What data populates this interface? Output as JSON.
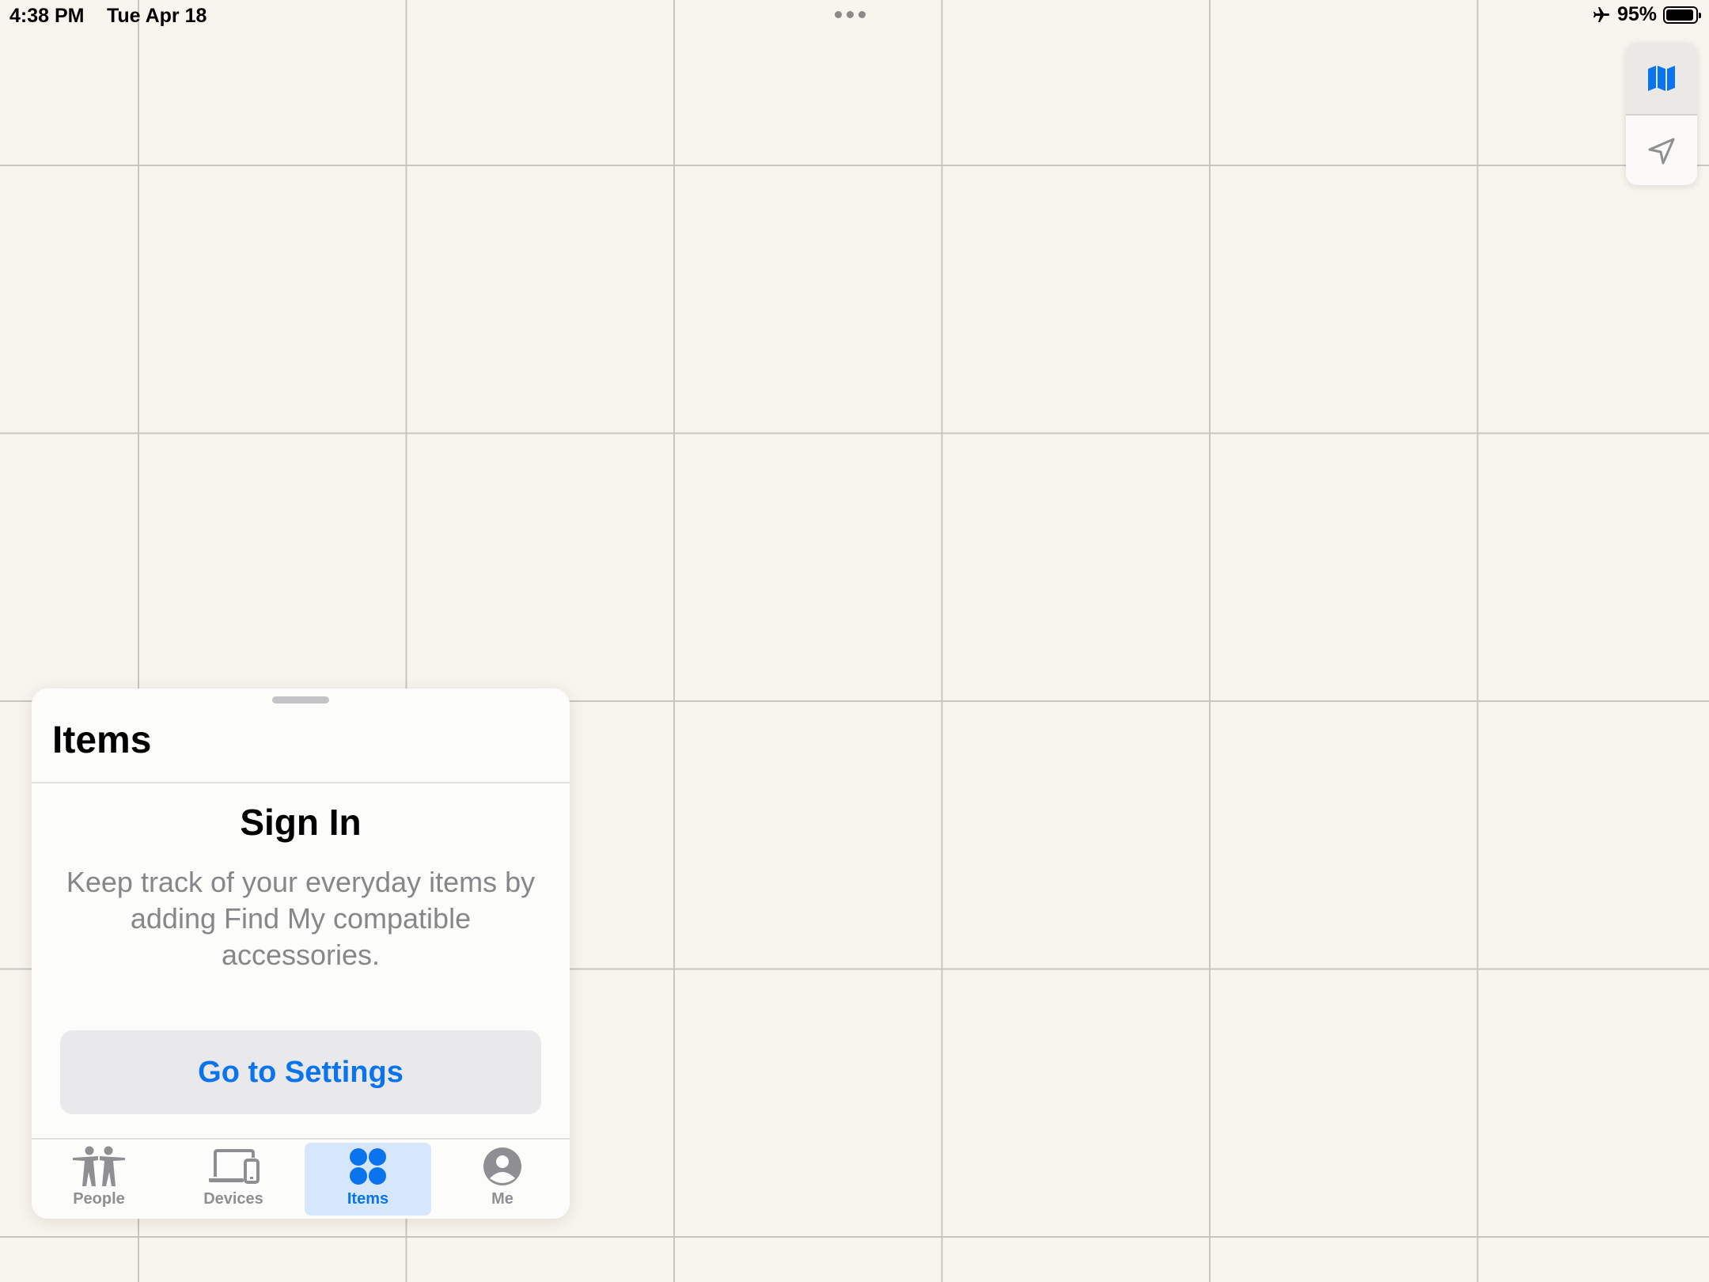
{
  "status_bar": {
    "time": "4:38 PM",
    "date": "Tue Apr 18",
    "battery_percent": "95%",
    "battery_level": 0.95,
    "airplane_mode_icon": "airplane-icon"
  },
  "map_controls": {
    "map_icon": "map-icon",
    "location_icon": "location-arrow-icon"
  },
  "sheet": {
    "title": "Items",
    "signin_title": "Sign In",
    "signin_description": "Keep track of your everyday items by adding Find My compatible accessories.",
    "settings_button": "Go to Settings"
  },
  "tabs": [
    {
      "label": "People",
      "icon": "people-icon",
      "active": false
    },
    {
      "label": "Devices",
      "icon": "devices-icon",
      "active": false
    },
    {
      "label": "Items",
      "icon": "items-icon",
      "active": true
    },
    {
      "label": "Me",
      "icon": "person-circle-icon",
      "active": false
    }
  ],
  "colors": {
    "accent": "#0a74ee",
    "map_background": "#f8f5ef",
    "secondary_text": "#86868b"
  }
}
